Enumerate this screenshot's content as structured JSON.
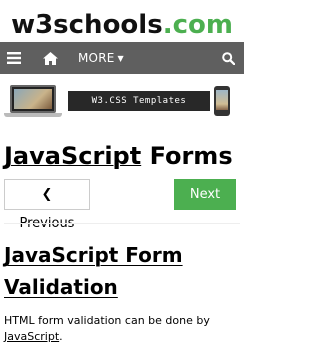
{
  "logo": {
    "brand": "w3schools",
    "suffix": ".com"
  },
  "nav": {
    "more_label": "MORE"
  },
  "banner": {
    "text": "W3.CSS Templates"
  },
  "page": {
    "title_link": "JavaScript",
    "title_rest": "Forms"
  },
  "buttons": {
    "previous": "❮ Previous",
    "next": "Next ❯"
  },
  "section": {
    "heading": "JavaScript Form Validation",
    "paragraph_text": "HTML form validation can be done by ",
    "paragraph_link": "JavaScript",
    "paragraph_end": "."
  },
  "colors": {
    "brand_green": "#4CAF50",
    "nav_bg": "#5f5f5f"
  },
  "icons": {
    "menu": "hamburger-menu-icon",
    "home": "home-icon",
    "more_caret": "caret-down-icon",
    "search": "search-icon"
  }
}
